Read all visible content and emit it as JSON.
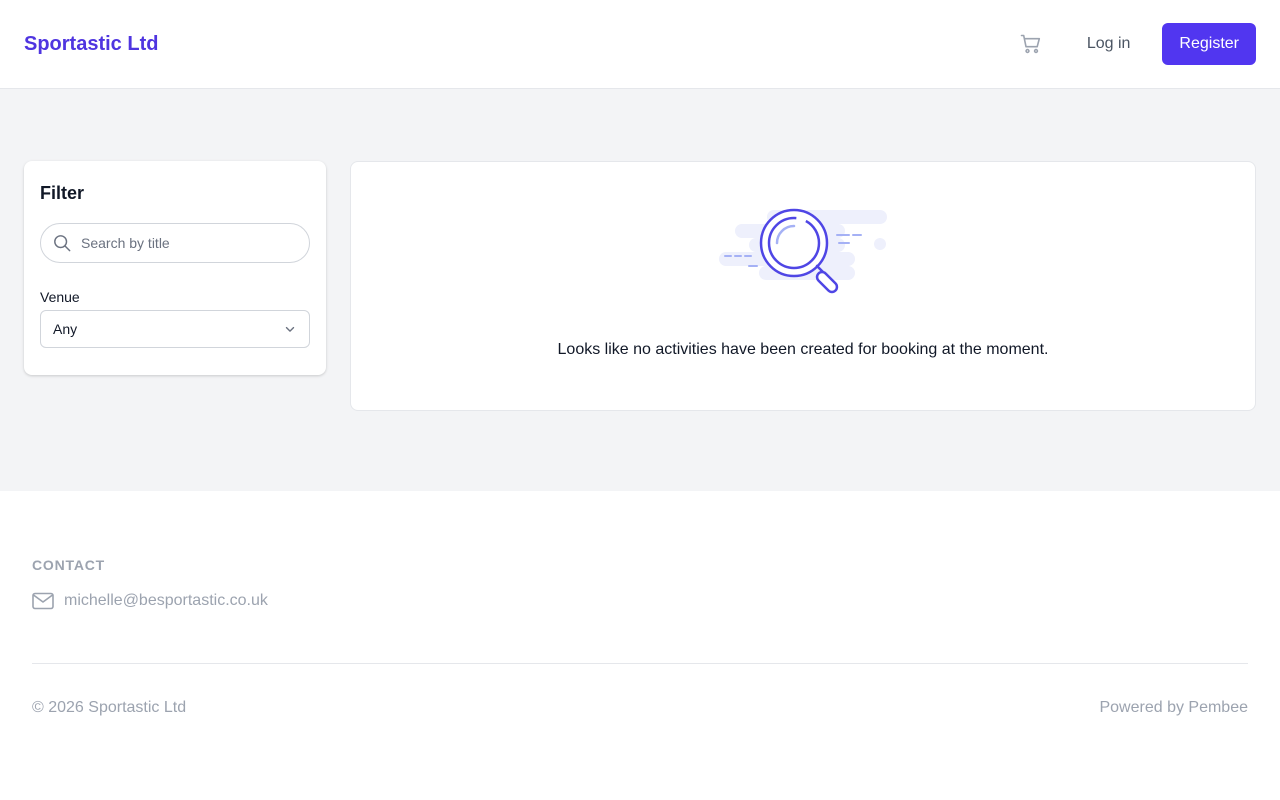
{
  "header": {
    "brand": "Sportastic Ltd",
    "cart_icon": "shopping-cart-icon",
    "login_label": "Log in",
    "register_label": "Register"
  },
  "filter": {
    "title": "Filter",
    "search_placeholder": "Search by title",
    "search_value": "",
    "search_icon": "search-icon",
    "venue_label": "Venue",
    "venue_selected": "Any",
    "chevron_icon": "chevron-down-icon"
  },
  "results": {
    "illustration_icon": "magnifying-glass-illustration",
    "empty_message": "Looks like no activities have been created for booking at the moment."
  },
  "footer": {
    "contact_heading": "CONTACT",
    "email_icon": "envelope-icon",
    "email": "michelle@besportastic.co.uk",
    "copyright": "© 2026 Sportastic Ltd",
    "powered_by": "Powered by Pembee"
  },
  "colors": {
    "brand": "#4f35e0",
    "primary_button": "#5136f0",
    "page_background": "#f3f4f6",
    "muted_text": "#9ca3af"
  }
}
